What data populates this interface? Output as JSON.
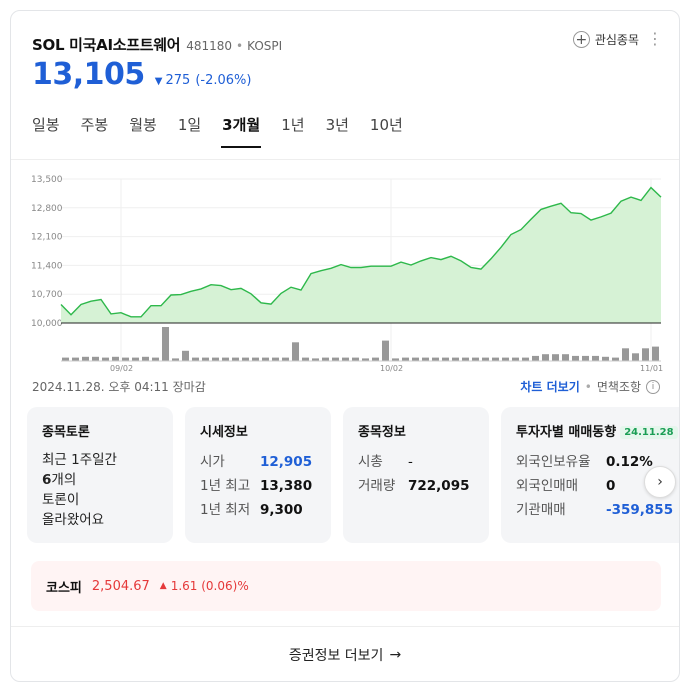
{
  "header": {
    "name": "SOL 미국AI소프트웨어",
    "code": "481180",
    "separator": "•",
    "market": "KOSPI",
    "watch_label": "관심종목",
    "more_icon": "⋮"
  },
  "quote": {
    "price": "13,105",
    "direction_icon": "▼",
    "change": "275",
    "change_rate": "(-2.06%)"
  },
  "tabs": [
    {
      "label": "일봉",
      "active": false
    },
    {
      "label": "주봉",
      "active": false
    },
    {
      "label": "월봉",
      "active": false
    },
    {
      "label": "1일",
      "active": false
    },
    {
      "label": "3개월",
      "active": true
    },
    {
      "label": "1년",
      "active": false
    },
    {
      "label": "3년",
      "active": false
    },
    {
      "label": "10년",
      "active": false
    }
  ],
  "chart_data": {
    "type": "area",
    "y_ticks": [
      "13,500",
      "12,800",
      "12,100",
      "11,400",
      "10,700",
      "10,000"
    ],
    "ylim": [
      10000,
      13500
    ],
    "x_ticks": [
      {
        "label": "09/02",
        "index": 6
      },
      {
        "label": "10/02",
        "index": 33
      },
      {
        "label": "11/01",
        "index": 59
      }
    ],
    "values": [
      10450,
      10200,
      10450,
      10530,
      10570,
      10220,
      10250,
      10150,
      10150,
      10420,
      10420,
      10680,
      10690,
      10770,
      10830,
      10930,
      10910,
      10810,
      10840,
      10710,
      10490,
      10460,
      10720,
      10870,
      10800,
      11200,
      11270,
      11330,
      11420,
      11350,
      11350,
      11380,
      11380,
      11380,
      11480,
      11410,
      11510,
      11590,
      11540,
      11620,
      11510,
      11350,
      11310,
      11560,
      11840,
      12150,
      12270,
      12520,
      12760,
      12840,
      12910,
      12680,
      12660,
      12500,
      12580,
      12670,
      12960,
      13060,
      12980,
      13290,
      13060
    ],
    "volumes": [
      4,
      4,
      5,
      5,
      4,
      5,
      4,
      4,
      5,
      4,
      40,
      3,
      12,
      4,
      4,
      4,
      4,
      4,
      4,
      4,
      4,
      4,
      4,
      22,
      4,
      3,
      4,
      4,
      4,
      4,
      3,
      4,
      24,
      3,
      4,
      4,
      4,
      4,
      4,
      4,
      4,
      4,
      4,
      4,
      4,
      4,
      4,
      6,
      8,
      8,
      8,
      6,
      6,
      6,
      5,
      4,
      15,
      9,
      15,
      17
    ],
    "colors": {
      "line": "#2eb84b",
      "area": "#d6f2d5",
      "volume": "#999999",
      "grid": "#efefef",
      "baseline": "#222222"
    }
  },
  "meta": {
    "timestamp": "2024.11.28. 오후 04:11 장마감",
    "chart_more": "차트 더보기",
    "separator": "•",
    "notice": "면책조항",
    "info_icon": "i"
  },
  "discussion": {
    "title": "종목토론",
    "line1": "최근 1주일간",
    "count": "6",
    "count_suffix": "개의",
    "line3": "토론이",
    "line4": "올라왔어요"
  },
  "price_info": {
    "title": "시세정보",
    "rows": [
      {
        "label": "시가",
        "value": "12,905",
        "blue": true
      },
      {
        "label": "1년 최고",
        "value": "13,380",
        "blue": false
      },
      {
        "label": "1년 최저",
        "value": "9,300",
        "blue": false
      }
    ]
  },
  "stock_info": {
    "title": "종목정보",
    "rows": [
      {
        "label": "시총",
        "value": "-"
      },
      {
        "label": "거래량",
        "value": "722,095"
      }
    ]
  },
  "investor": {
    "title": "투자자별 매매동향",
    "badge": "24.11.28",
    "rows": [
      {
        "label": "외국인보유율",
        "value": "0.12%",
        "blue": false
      },
      {
        "label": "외국인매매",
        "value": "0",
        "blue": false
      },
      {
        "label": "기관매매",
        "value": "-359,855",
        "blue": true
      }
    ]
  },
  "next_icon": "›",
  "kospi": {
    "label": "코스피",
    "value": "2,504.67",
    "direction_icon": "▲",
    "change": "1.61 (0.06)%"
  },
  "footer": {
    "label": "증권정보 더보기",
    "arrow": "→"
  }
}
